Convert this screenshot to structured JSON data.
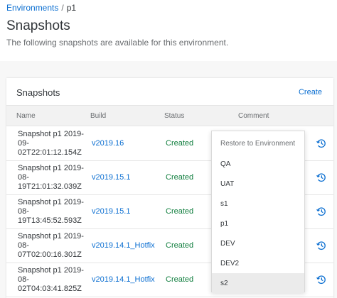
{
  "breadcrumb": {
    "parent": "Environments",
    "separator": "/",
    "current": "p1"
  },
  "page": {
    "title": "Snapshots",
    "subtitle": "The following snapshots are available for this environment."
  },
  "panel": {
    "title": "Snapshots",
    "create_label": "Create",
    "columns": {
      "name": "Name",
      "build": "Build",
      "status": "Status",
      "comment": "Comment"
    },
    "rows": [
      {
        "name": "Snapshot p1 2019-09-02T22:01:12.154Z",
        "build": "v2019.16",
        "status": "Created"
      },
      {
        "name": "Snapshot p1 2019-08-19T21:01:32.039Z",
        "build": "v2019.15.1",
        "status": "Created"
      },
      {
        "name": "Snapshot p1 2019-08-19T13:45:52.593Z",
        "build": "v2019.15.1",
        "status": "Created"
      },
      {
        "name": "Snapshot p1 2019-08-07T02:00:16.301Z",
        "build": "v2019.14.1_Hotfix",
        "status": "Created"
      },
      {
        "name": "Snapshot p1 2019-08-02T04:03:41.825Z",
        "build": "v2019.14.1_Hotfix",
        "status": "Created"
      }
    ]
  },
  "restore_menu": {
    "header": "Restore to Environment",
    "items": [
      "QA",
      "UAT",
      "s1",
      "p1",
      "DEV",
      "DEV2",
      "s2"
    ],
    "active_item": "s2"
  },
  "colors": {
    "link": "#0a6ed1",
    "status_created": "#107e3e"
  },
  "icons": {
    "restore": "history-restore-icon"
  }
}
